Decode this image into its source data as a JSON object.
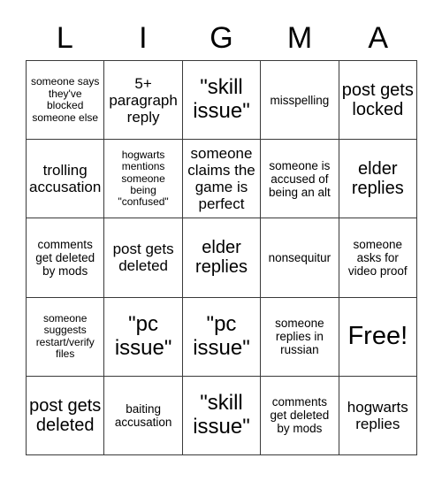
{
  "card": {
    "header_letters": [
      "L",
      "I",
      "G",
      "M",
      "A"
    ],
    "rows": [
      [
        {
          "text": "someone says they've blocked someone else",
          "size": "xs"
        },
        {
          "text": "5+ paragraph reply",
          "size": "m"
        },
        {
          "text": "\"skill issue\"",
          "size": "xl"
        },
        {
          "text": "misspelling",
          "size": "s"
        },
        {
          "text": "post gets locked",
          "size": "l"
        }
      ],
      [
        {
          "text": "trolling accusation",
          "size": "m"
        },
        {
          "text": "hogwarts mentions someone being \"confused\"",
          "size": "xs"
        },
        {
          "text": "someone claims the game is perfect",
          "size": "m"
        },
        {
          "text": "someone is accused of being an alt",
          "size": "s"
        },
        {
          "text": "elder replies",
          "size": "l"
        }
      ],
      [
        {
          "text": "comments get deleted by mods",
          "size": "s"
        },
        {
          "text": "post gets deleted",
          "size": "m"
        },
        {
          "text": "elder replies",
          "size": "l"
        },
        {
          "text": "nonsequitur",
          "size": "s"
        },
        {
          "text": "someone asks for video proof",
          "size": "s"
        }
      ],
      [
        {
          "text": "someone suggests restart/verify files",
          "size": "xs"
        },
        {
          "text": "\"pc issue\"",
          "size": "xl"
        },
        {
          "text": "\"pc issue\"",
          "size": "xl"
        },
        {
          "text": "someone replies in russian",
          "size": "s"
        },
        {
          "text": "Free!",
          "size": "xxl"
        }
      ],
      [
        {
          "text": "post gets deleted",
          "size": "l"
        },
        {
          "text": "baiting accusation",
          "size": "s"
        },
        {
          "text": "\"skill issue\"",
          "size": "xl"
        },
        {
          "text": "comments get deleted by mods",
          "size": "s"
        },
        {
          "text": "hogwarts replies",
          "size": "m"
        }
      ]
    ],
    "colors": {
      "background": "#ffffff",
      "text": "#000000",
      "grid_line": "#3a3a3a"
    }
  }
}
